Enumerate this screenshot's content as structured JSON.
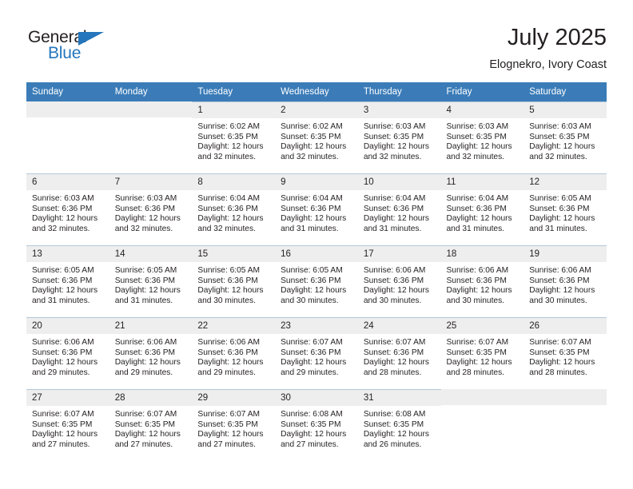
{
  "brand": {
    "name_top": "General",
    "name_bottom": "Blue",
    "accent_color": "#2576bc"
  },
  "header": {
    "month_title": "July 2025",
    "location": "Elognekro, Ivory Coast"
  },
  "calendar": {
    "header_color": "#3b7cb8",
    "daynum_strip_color": "#eeeeee",
    "weekday_headers": [
      "Sunday",
      "Monday",
      "Tuesday",
      "Wednesday",
      "Thursday",
      "Friday",
      "Saturday"
    ],
    "labels": {
      "sunrise": "Sunrise:",
      "sunset": "Sunset:",
      "daylight": "Daylight:"
    },
    "weeks": [
      [
        {
          "day": "",
          "sunrise": "",
          "sunset": "",
          "daylight_line1": "",
          "daylight_line2": ""
        },
        {
          "day": "",
          "sunrise": "",
          "sunset": "",
          "daylight_line1": "",
          "daylight_line2": ""
        },
        {
          "day": "1",
          "sunrise": "Sunrise: 6:02 AM",
          "sunset": "Sunset: 6:35 PM",
          "daylight_line1": "Daylight: 12 hours",
          "daylight_line2": "and 32 minutes."
        },
        {
          "day": "2",
          "sunrise": "Sunrise: 6:02 AM",
          "sunset": "Sunset: 6:35 PM",
          "daylight_line1": "Daylight: 12 hours",
          "daylight_line2": "and 32 minutes."
        },
        {
          "day": "3",
          "sunrise": "Sunrise: 6:03 AM",
          "sunset": "Sunset: 6:35 PM",
          "daylight_line1": "Daylight: 12 hours",
          "daylight_line2": "and 32 minutes."
        },
        {
          "day": "4",
          "sunrise": "Sunrise: 6:03 AM",
          "sunset": "Sunset: 6:35 PM",
          "daylight_line1": "Daylight: 12 hours",
          "daylight_line2": "and 32 minutes."
        },
        {
          "day": "5",
          "sunrise": "Sunrise: 6:03 AM",
          "sunset": "Sunset: 6:35 PM",
          "daylight_line1": "Daylight: 12 hours",
          "daylight_line2": "and 32 minutes."
        }
      ],
      [
        {
          "day": "6",
          "sunrise": "Sunrise: 6:03 AM",
          "sunset": "Sunset: 6:36 PM",
          "daylight_line1": "Daylight: 12 hours",
          "daylight_line2": "and 32 minutes."
        },
        {
          "day": "7",
          "sunrise": "Sunrise: 6:03 AM",
          "sunset": "Sunset: 6:36 PM",
          "daylight_line1": "Daylight: 12 hours",
          "daylight_line2": "and 32 minutes."
        },
        {
          "day": "8",
          "sunrise": "Sunrise: 6:04 AM",
          "sunset": "Sunset: 6:36 PM",
          "daylight_line1": "Daylight: 12 hours",
          "daylight_line2": "and 32 minutes."
        },
        {
          "day": "9",
          "sunrise": "Sunrise: 6:04 AM",
          "sunset": "Sunset: 6:36 PM",
          "daylight_line1": "Daylight: 12 hours",
          "daylight_line2": "and 31 minutes."
        },
        {
          "day": "10",
          "sunrise": "Sunrise: 6:04 AM",
          "sunset": "Sunset: 6:36 PM",
          "daylight_line1": "Daylight: 12 hours",
          "daylight_line2": "and 31 minutes."
        },
        {
          "day": "11",
          "sunrise": "Sunrise: 6:04 AM",
          "sunset": "Sunset: 6:36 PM",
          "daylight_line1": "Daylight: 12 hours",
          "daylight_line2": "and 31 minutes."
        },
        {
          "day": "12",
          "sunrise": "Sunrise: 6:05 AM",
          "sunset": "Sunset: 6:36 PM",
          "daylight_line1": "Daylight: 12 hours",
          "daylight_line2": "and 31 minutes."
        }
      ],
      [
        {
          "day": "13",
          "sunrise": "Sunrise: 6:05 AM",
          "sunset": "Sunset: 6:36 PM",
          "daylight_line1": "Daylight: 12 hours",
          "daylight_line2": "and 31 minutes."
        },
        {
          "day": "14",
          "sunrise": "Sunrise: 6:05 AM",
          "sunset": "Sunset: 6:36 PM",
          "daylight_line1": "Daylight: 12 hours",
          "daylight_line2": "and 31 minutes."
        },
        {
          "day": "15",
          "sunrise": "Sunrise: 6:05 AM",
          "sunset": "Sunset: 6:36 PM",
          "daylight_line1": "Daylight: 12 hours",
          "daylight_line2": "and 30 minutes."
        },
        {
          "day": "16",
          "sunrise": "Sunrise: 6:05 AM",
          "sunset": "Sunset: 6:36 PM",
          "daylight_line1": "Daylight: 12 hours",
          "daylight_line2": "and 30 minutes."
        },
        {
          "day": "17",
          "sunrise": "Sunrise: 6:06 AM",
          "sunset": "Sunset: 6:36 PM",
          "daylight_line1": "Daylight: 12 hours",
          "daylight_line2": "and 30 minutes."
        },
        {
          "day": "18",
          "sunrise": "Sunrise: 6:06 AM",
          "sunset": "Sunset: 6:36 PM",
          "daylight_line1": "Daylight: 12 hours",
          "daylight_line2": "and 30 minutes."
        },
        {
          "day": "19",
          "sunrise": "Sunrise: 6:06 AM",
          "sunset": "Sunset: 6:36 PM",
          "daylight_line1": "Daylight: 12 hours",
          "daylight_line2": "and 30 minutes."
        }
      ],
      [
        {
          "day": "20",
          "sunrise": "Sunrise: 6:06 AM",
          "sunset": "Sunset: 6:36 PM",
          "daylight_line1": "Daylight: 12 hours",
          "daylight_line2": "and 29 minutes."
        },
        {
          "day": "21",
          "sunrise": "Sunrise: 6:06 AM",
          "sunset": "Sunset: 6:36 PM",
          "daylight_line1": "Daylight: 12 hours",
          "daylight_line2": "and 29 minutes."
        },
        {
          "day": "22",
          "sunrise": "Sunrise: 6:06 AM",
          "sunset": "Sunset: 6:36 PM",
          "daylight_line1": "Daylight: 12 hours",
          "daylight_line2": "and 29 minutes."
        },
        {
          "day": "23",
          "sunrise": "Sunrise: 6:07 AM",
          "sunset": "Sunset: 6:36 PM",
          "daylight_line1": "Daylight: 12 hours",
          "daylight_line2": "and 29 minutes."
        },
        {
          "day": "24",
          "sunrise": "Sunrise: 6:07 AM",
          "sunset": "Sunset: 6:36 PM",
          "daylight_line1": "Daylight: 12 hours",
          "daylight_line2": "and 28 minutes."
        },
        {
          "day": "25",
          "sunrise": "Sunrise: 6:07 AM",
          "sunset": "Sunset: 6:35 PM",
          "daylight_line1": "Daylight: 12 hours",
          "daylight_line2": "and 28 minutes."
        },
        {
          "day": "26",
          "sunrise": "Sunrise: 6:07 AM",
          "sunset": "Sunset: 6:35 PM",
          "daylight_line1": "Daylight: 12 hours",
          "daylight_line2": "and 28 minutes."
        }
      ],
      [
        {
          "day": "27",
          "sunrise": "Sunrise: 6:07 AM",
          "sunset": "Sunset: 6:35 PM",
          "daylight_line1": "Daylight: 12 hours",
          "daylight_line2": "and 27 minutes."
        },
        {
          "day": "28",
          "sunrise": "Sunrise: 6:07 AM",
          "sunset": "Sunset: 6:35 PM",
          "daylight_line1": "Daylight: 12 hours",
          "daylight_line2": "and 27 minutes."
        },
        {
          "day": "29",
          "sunrise": "Sunrise: 6:07 AM",
          "sunset": "Sunset: 6:35 PM",
          "daylight_line1": "Daylight: 12 hours",
          "daylight_line2": "and 27 minutes."
        },
        {
          "day": "30",
          "sunrise": "Sunrise: 6:08 AM",
          "sunset": "Sunset: 6:35 PM",
          "daylight_line1": "Daylight: 12 hours",
          "daylight_line2": "and 27 minutes."
        },
        {
          "day": "31",
          "sunrise": "Sunrise: 6:08 AM",
          "sunset": "Sunset: 6:35 PM",
          "daylight_line1": "Daylight: 12 hours",
          "daylight_line2": "and 26 minutes."
        },
        {
          "day": "",
          "sunrise": "",
          "sunset": "",
          "daylight_line1": "",
          "daylight_line2": ""
        },
        {
          "day": "",
          "sunrise": "",
          "sunset": "",
          "daylight_line1": "",
          "daylight_line2": ""
        }
      ]
    ]
  }
}
